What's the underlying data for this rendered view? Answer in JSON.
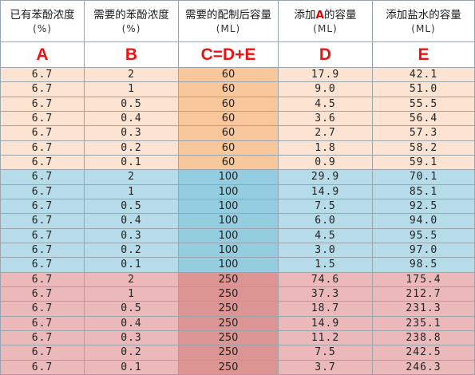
{
  "headers": [
    {
      "line1": "已有苯酚浓度",
      "line2": "(%)",
      "letter": "A"
    },
    {
      "line1": "需要的苯酚浓度",
      "line2": "(%)",
      "letter": "B"
    },
    {
      "line1": "需要的配制后容量",
      "line2": "(ML)",
      "letter": "C=D+E"
    },
    {
      "line1_pre": "添加",
      "line1_red": "A",
      "line1_post": "的容量",
      "line2": "(ML)",
      "letter": "D"
    },
    {
      "line1": "添加盐水的容量",
      "line2": "(ML)",
      "letter": "E"
    }
  ],
  "rows": [
    [
      "6.7",
      "2",
      "60",
      "17.9",
      "42.1"
    ],
    [
      "6.7",
      "1",
      "60",
      "9.0",
      "51.0"
    ],
    [
      "6.7",
      "0.5",
      "60",
      "4.5",
      "55.5"
    ],
    [
      "6.7",
      "0.4",
      "60",
      "3.6",
      "56.4"
    ],
    [
      "6.7",
      "0.3",
      "60",
      "2.7",
      "57.3"
    ],
    [
      "6.7",
      "0.2",
      "60",
      "1.8",
      "58.2"
    ],
    [
      "6.7",
      "0.1",
      "60",
      "0.9",
      "59.1"
    ],
    [
      "6.7",
      "2",
      "100",
      "29.9",
      "70.1"
    ],
    [
      "6.7",
      "1",
      "100",
      "14.9",
      "85.1"
    ],
    [
      "6.7",
      "0.5",
      "100",
      "7.5",
      "92.5"
    ],
    [
      "6.7",
      "0.4",
      "100",
      "6.0",
      "94.0"
    ],
    [
      "6.7",
      "0.3",
      "100",
      "4.5",
      "95.5"
    ],
    [
      "6.7",
      "0.2",
      "100",
      "3.0",
      "97.0"
    ],
    [
      "6.7",
      "0.1",
      "100",
      "1.5",
      "98.5"
    ],
    [
      "6.7",
      "2",
      "250",
      "74.6",
      "175.4"
    ],
    [
      "6.7",
      "1",
      "250",
      "37.3",
      "212.7"
    ],
    [
      "6.7",
      "0.5",
      "250",
      "18.7",
      "231.3"
    ],
    [
      "6.7",
      "0.4",
      "250",
      "14.9",
      "235.1"
    ],
    [
      "6.7",
      "0.3",
      "250",
      "11.2",
      "238.8"
    ],
    [
      "6.7",
      "0.2",
      "250",
      "7.5",
      "242.5"
    ],
    [
      "6.7",
      "0.1",
      "250",
      "3.7",
      "246.3"
    ]
  ],
  "colors": {
    "band_60": "#fde4d2",
    "band_60_c": "#f9c79c",
    "band_100": "#b6dce9",
    "band_100_c": "#94cde0",
    "band_250": "#ebb9b9",
    "band_250_c": "#dc9593",
    "letter_red": "#ee1111"
  }
}
